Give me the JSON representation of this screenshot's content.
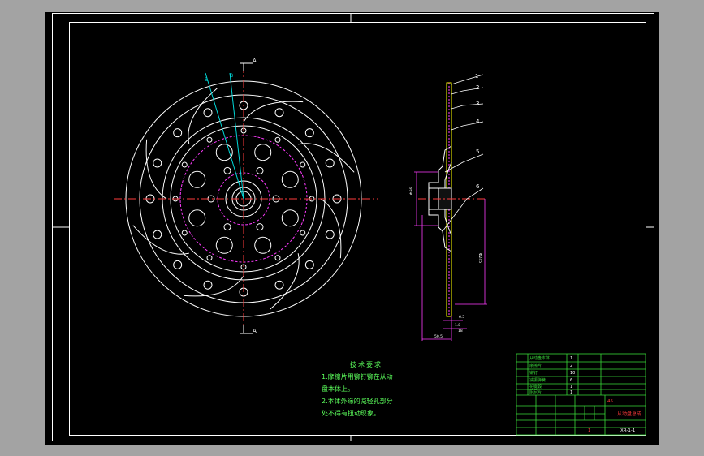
{
  "drawing": {
    "section_marks": [
      "A",
      "A"
    ],
    "balloons": [
      "1",
      "2",
      "3",
      "4",
      "5",
      "6"
    ]
  },
  "notes": {
    "title": "技术要求",
    "lines": [
      "1.摩擦片用铆钉铆在从动",
      "盘本体上。",
      "2.本体外缘的减轻孔部分",
      "处不得有扭动现象。"
    ]
  },
  "title_block": {
    "part_name": "从动盘总成",
    "drawing_no": "XR-1-1",
    "material": "45",
    "qty": "1"
  },
  "colors": {
    "background": "#000000",
    "lines": "#ffffff",
    "centerline": "#ff3b3b",
    "dimension": "#ff3bff",
    "cyan": "#00d8d8",
    "notes": "#5cff5c",
    "title_block": "#39d839"
  }
}
